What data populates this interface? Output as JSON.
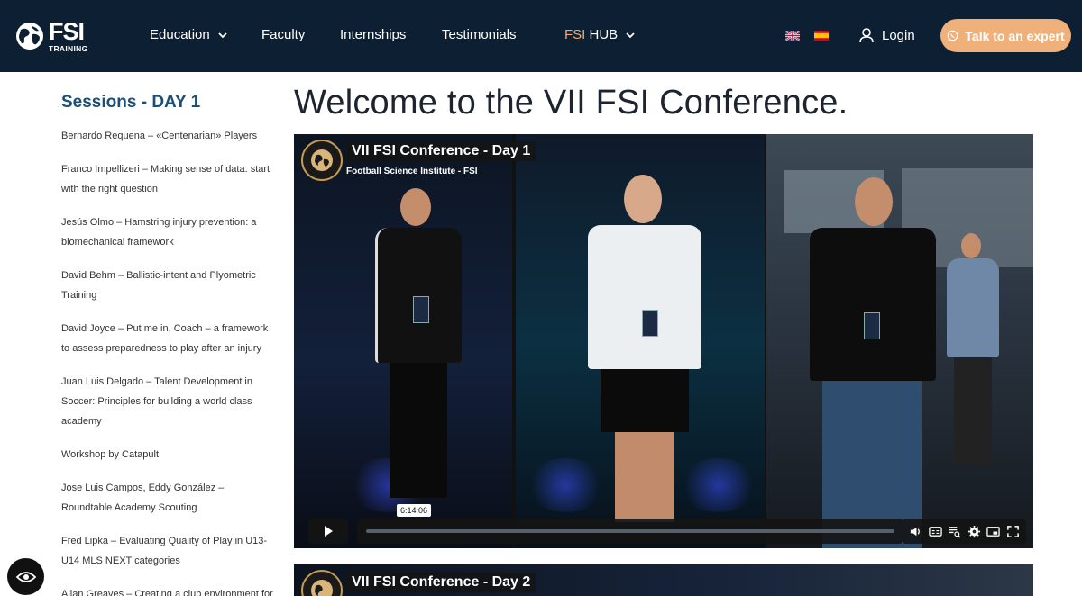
{
  "header": {
    "logo": {
      "brand": "FSI",
      "tagline": "TRAINING"
    },
    "nav": [
      {
        "label": "Education",
        "has_dropdown": true
      },
      {
        "label": "Faculty",
        "has_dropdown": false
      },
      {
        "label": "Internships",
        "has_dropdown": false
      },
      {
        "label": "Testimonials",
        "has_dropdown": false
      },
      {
        "label_prefix": "FSI",
        "label": "HUB",
        "has_dropdown": true
      }
    ],
    "languages": [
      "english-flag-icon",
      "spanish-flag-icon"
    ],
    "login_label": "Login",
    "cta_label": "Talk to an expert",
    "accent_color": "#f0b07a",
    "bg_color": "#0d1f33"
  },
  "sidebar": {
    "title": "Sessions - DAY 1",
    "items": [
      "Bernardo Requena – «Centenarian» Players",
      "Franco Impellizeri – Making sense of data: start with the right question",
      "Jesús Olmo – Hamstring injury prevention: a biomechanical framework",
      "David Behm – Ballistic-intent and Plyometric Training",
      "David Joyce – Put me in, Coach – a framework to assess preparedness to play after an injury",
      "Juan Luis Delgado – Talent Development in Soccer: Principles for building a world class academy",
      "Workshop by Catapult",
      "Jose Luis Campos, Eddy González – Roundtable Academy Scouting",
      "Fred Lipka – Evaluating Quality of Play in U13-U14 MLS NEXT categories",
      "Allan Greaves – Creating a club environment for"
    ]
  },
  "main": {
    "title": "Welcome to the VII FSI Conference.",
    "videos": [
      {
        "title": "VII FSI Conference - Day 1",
        "channel": "Football Science Institute - FSI",
        "hover_time": "6:14:06"
      },
      {
        "title": "VII FSI Conference - Day 2"
      }
    ]
  }
}
